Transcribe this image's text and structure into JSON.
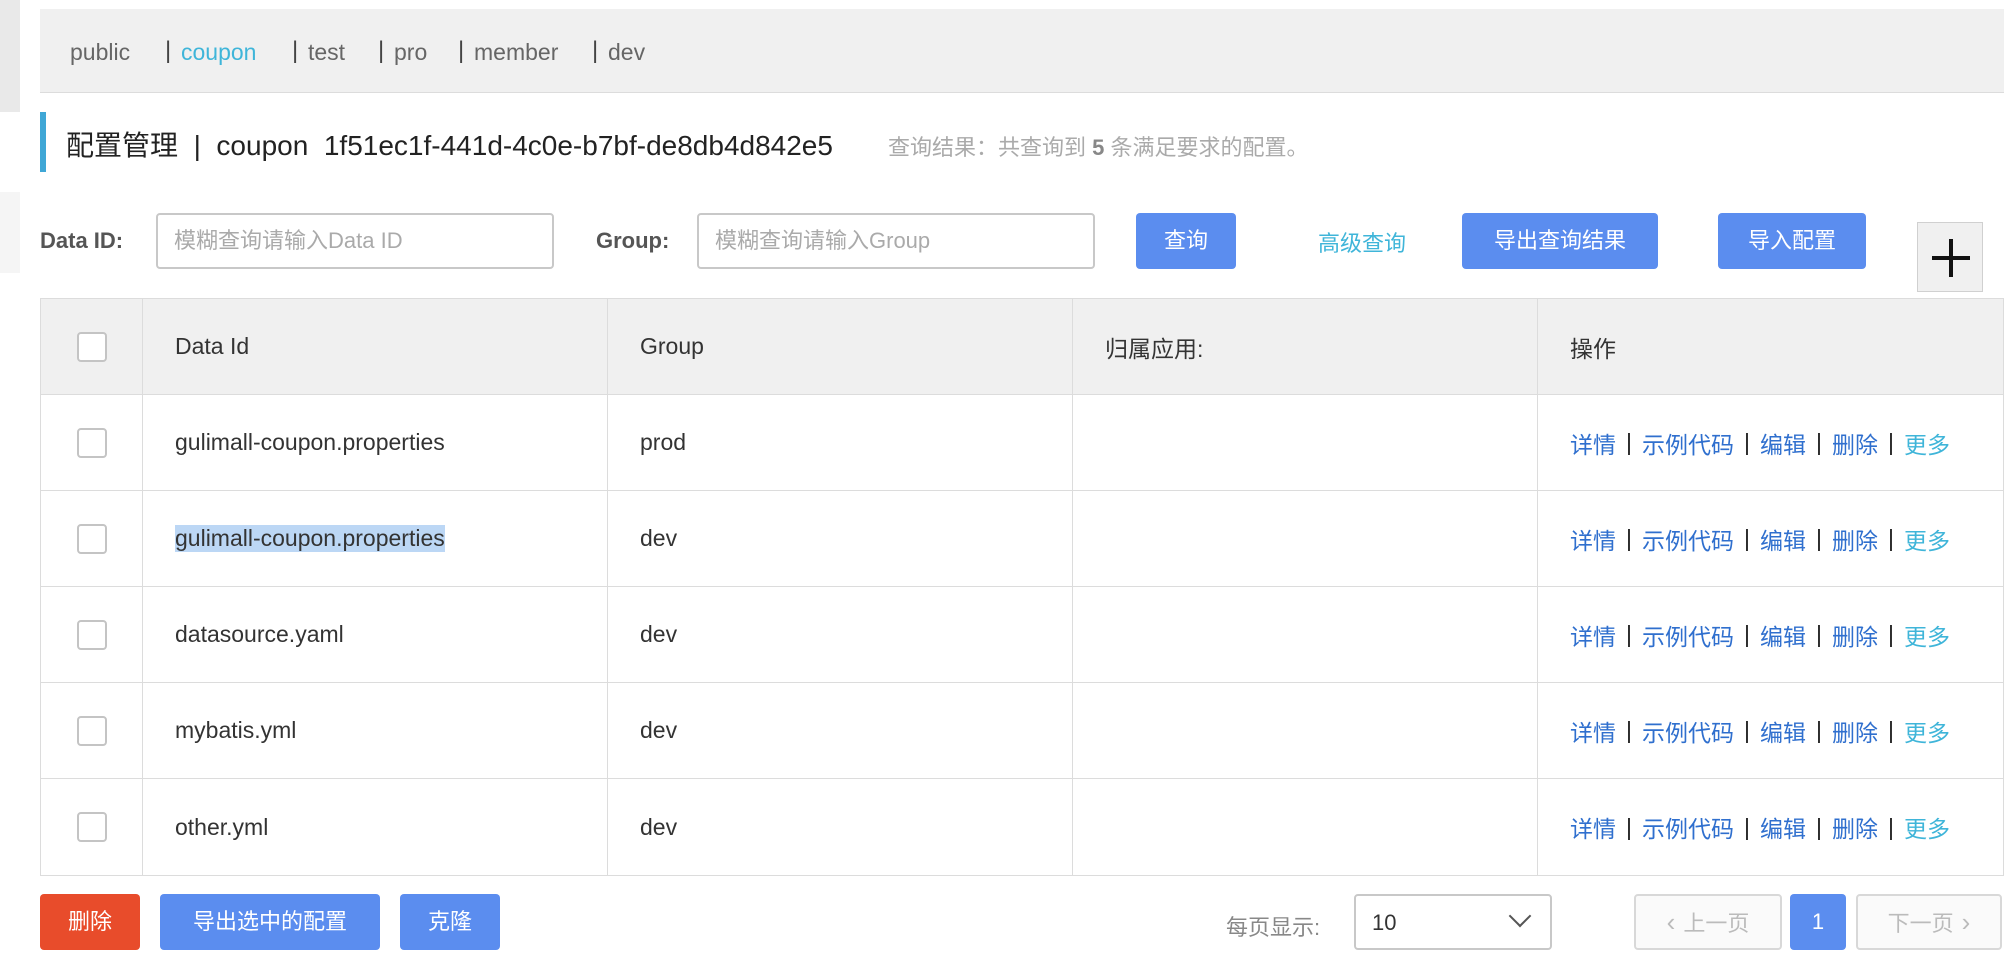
{
  "namespaces": [
    {
      "label": "public",
      "active": false
    },
    {
      "label": "coupon",
      "active": true
    },
    {
      "label": "test",
      "active": false
    },
    {
      "label": "pro",
      "active": false
    },
    {
      "label": "member",
      "active": false
    },
    {
      "label": "dev",
      "active": false
    }
  ],
  "title": {
    "prefix": "配置管理",
    "separator": "|",
    "namespace_name": "coupon",
    "namespace_id": "1f51ec1f-441d-4c0e-b7bf-de8db4d842e5"
  },
  "result": {
    "before": "查询结果：共查询到",
    "count": "5",
    "after": "条满足要求的配置。"
  },
  "search": {
    "data_id_label": "Data ID:",
    "data_id_placeholder": "模糊查询请输入Data ID",
    "data_id_value": "",
    "group_label": "Group:",
    "group_placeholder": "模糊查询请输入Group",
    "group_value": "",
    "query_button": "查询",
    "advanced_query": "高级查询",
    "export_results": "导出查询结果",
    "import_config": "导入配置"
  },
  "table": {
    "headers": [
      "Data Id",
      "Group",
      "归属应用:",
      "操作"
    ],
    "rows": [
      {
        "data_id": "gulimall-coupon.properties",
        "group": "prod",
        "app": "",
        "selected_text": false
      },
      {
        "data_id": "gulimall-coupon.properties",
        "group": "dev",
        "app": "",
        "selected_text": true
      },
      {
        "data_id": "datasource.yaml",
        "group": "dev",
        "app": "",
        "selected_text": false
      },
      {
        "data_id": "mybatis.yml",
        "group": "dev",
        "app": "",
        "selected_text": false
      },
      {
        "data_id": "other.yml",
        "group": "dev",
        "app": "",
        "selected_text": false
      }
    ],
    "ops": {
      "detail": "详情",
      "sample": "示例代码",
      "edit": "编辑",
      "delete": "删除",
      "more": "更多",
      "sep": "|"
    }
  },
  "footer": {
    "delete": "删除",
    "export_selected": "导出选中的配置",
    "clone": "克隆",
    "page_size_label": "每页显示:",
    "page_size": "10",
    "prev": "上一页",
    "current_page": "1",
    "next": "下一页"
  },
  "colors": {
    "primary": "#5b8def",
    "danger": "#e84c2b",
    "link": "#2f6fce",
    "accent_link": "#3fb5d9",
    "title_accent": "#3fa7d6"
  }
}
